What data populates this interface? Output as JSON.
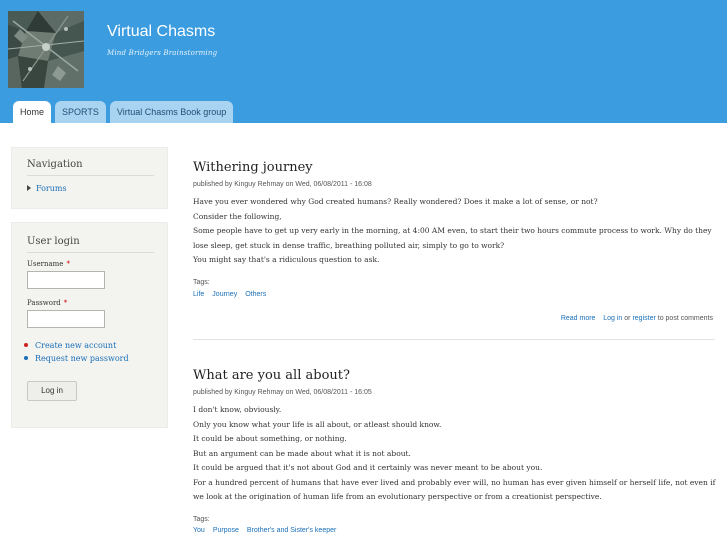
{
  "site": {
    "name": "Virtual Chasms",
    "slogan": "Mind Bridgers Brainstorming"
  },
  "tabs": [
    {
      "label": "Home",
      "active": true
    },
    {
      "label": "SPORTS",
      "active": false
    },
    {
      "label": "Virtual Chasms Book group",
      "active": false
    }
  ],
  "navigation": {
    "title": "Navigation",
    "items": [
      {
        "label": "Forums"
      }
    ]
  },
  "login": {
    "title": "User login",
    "username_label": "Username",
    "password_label": "Password",
    "required_mark": "*",
    "links": [
      {
        "label": "Create new account",
        "bullet_color": "#cc2222"
      },
      {
        "label": "Request new password",
        "bullet_color": "#1a6fb8"
      }
    ],
    "button_label": "Log in"
  },
  "posts": [
    {
      "title": "Withering journey",
      "submitted": "published by Kinguy Rehmay on Wed, 06/08/2011 - 16:08",
      "lines": [
        "Have you ever wondered why God created humans? Really wondered? Does it make a lot of sense, or not?",
        "Consider the following,",
        "Some people have to get up very early in the morning, at 4:00 AM even, to start their two hours commute process to work. Why do they lose sleep, get stuck in dense traffic, breathing polluted air, simply to go to work?",
        "You might say that's a ridiculous question to ask."
      ],
      "tags_label": "Tags:",
      "tags": [
        "Life",
        "Journey",
        "Others"
      ],
      "read_more": "Read more",
      "login_link": "Log in",
      "or_text": "or",
      "register_link": "register",
      "post_comments_text": "to post comments"
    },
    {
      "title": "What are you all about?",
      "submitted": "published by Kinguy Rehmay on Wed, 06/08/2011 - 16:05",
      "lines": [
        "I don't know, obviously.",
        "Only you know what your life is all about, or atleast should know.",
        "It could be about something, or nothing.",
        "But an argument can be made about what it is not about.",
        "It could be argued that it's not about God and it certainly was never meant to be about you.",
        "For a hundred percent of humans that have ever lived and probably ever will, no human has ever given himself or herself life, not even if we look at the origination of human life from an evolutionary perspective or from a creationist perspective."
      ],
      "tags_label": "Tags:",
      "tags": [
        "You",
        "Purpose",
        "Brother's and Sister's keeper"
      ]
    }
  ]
}
